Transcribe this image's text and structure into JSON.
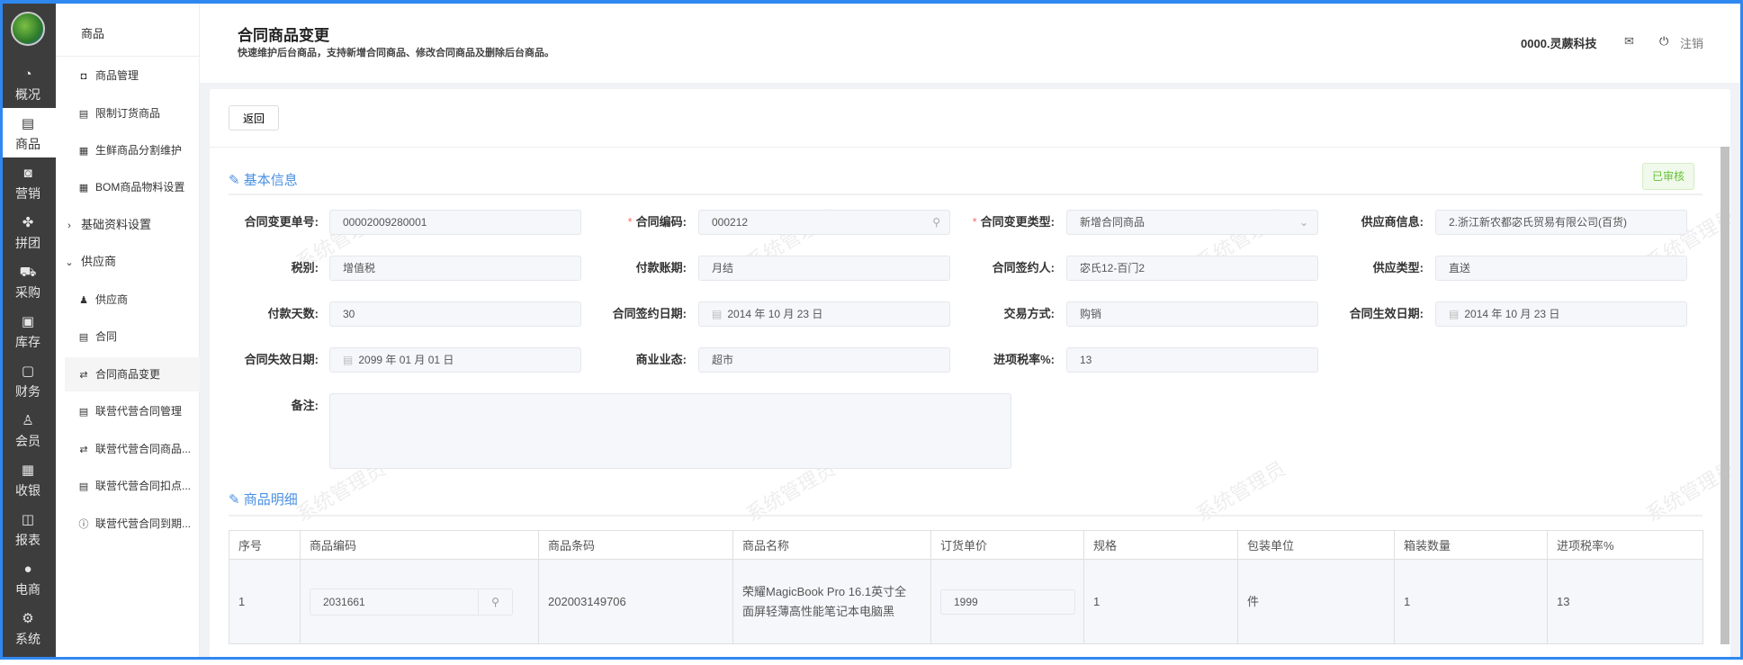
{
  "sidebar": {
    "items": [
      {
        "label": "概况",
        "icon": "dashboard-icon"
      },
      {
        "label": "商品",
        "icon": "document-icon"
      },
      {
        "label": "营销",
        "icon": "marketing-icon"
      },
      {
        "label": "拼团",
        "icon": "clover-icon"
      },
      {
        "label": "采购",
        "icon": "cart-icon"
      },
      {
        "label": "库存",
        "icon": "box-icon"
      },
      {
        "label": "财务",
        "icon": "money-icon"
      },
      {
        "label": "会员",
        "icon": "user-icon"
      },
      {
        "label": "收银",
        "icon": "register-icon"
      },
      {
        "label": "报表",
        "icon": "report-icon"
      },
      {
        "label": "电商",
        "icon": "person-icon"
      },
      {
        "label": "系统",
        "icon": "gear-icon"
      }
    ]
  },
  "submenu": {
    "title": "商品",
    "items": [
      {
        "label": "商品管理"
      },
      {
        "label": "限制订货商品"
      },
      {
        "label": "生鲜商品分割维护"
      },
      {
        "label": "BOM商品物料设置"
      },
      {
        "label": "基础资料设置"
      },
      {
        "label": "供应商"
      },
      {
        "label": "供应商"
      },
      {
        "label": "合同"
      },
      {
        "label": "合同商品变更"
      },
      {
        "label": "联营代营合同管理"
      },
      {
        "label": "联营代营合同商品..."
      },
      {
        "label": "联营代营合同扣点..."
      },
      {
        "label": "联营代营合同到期..."
      }
    ]
  },
  "header": {
    "title": "合同商品变更",
    "subtitle": "快速维护后台商品，支持新增合同商品、修改合同商品及删除后台商品。",
    "company": "0000.灵蕨科技",
    "logout": "注销"
  },
  "toolbar": {
    "back": "返回"
  },
  "basic": {
    "title": "基本信息",
    "status": "已审核",
    "fields": [
      {
        "label": "合同变更单号:",
        "value": "00002009280001"
      },
      {
        "label": "合同编码:",
        "value": "000212"
      },
      {
        "label": "合同变更类型:",
        "value": "新增合同商品"
      },
      {
        "label": "供应商信息:",
        "value": "2.浙江新农都宓氏贸易有限公司(百货)"
      },
      {
        "label": "税别:",
        "value": "增值税"
      },
      {
        "label": "付款账期:",
        "value": "月结"
      },
      {
        "label": "合同签约人:",
        "value": "宓氏12-百门2"
      },
      {
        "label": "供应类型:",
        "value": "直送"
      },
      {
        "label": "付款天数:",
        "value": "30"
      },
      {
        "label": "合同签约日期:",
        "value": "2014 年 10 月 23 日"
      },
      {
        "label": "交易方式:",
        "value": "购销"
      },
      {
        "label": "合同生效日期:",
        "value": "2014 年 10 月 23 日"
      },
      {
        "label": "合同失效日期:",
        "value": "2099 年 01 月 01 日"
      },
      {
        "label": "商业业态:",
        "value": "超市"
      },
      {
        "label": "进项税率%:",
        "value": "13"
      }
    ],
    "remark_label": "备注:",
    "remark": ""
  },
  "detail": {
    "title": "商品明细",
    "columns": [
      "序号",
      "商品编码",
      "商品条码",
      "商品名称",
      "订货单价",
      "规格",
      "包装单位",
      "箱装数量",
      "进项税率%"
    ],
    "rows": [
      {
        "no": "1",
        "code": "2031661",
        "barcode": "202003149706",
        "name": "荣耀MagicBook Pro 16.1英寸全面屏轻薄高性能笔记本电脑黑",
        "price": "1999",
        "spec": "1",
        "unit": "件",
        "qty": "1",
        "tax": "13"
      }
    ]
  },
  "watermark": "系统管理员"
}
